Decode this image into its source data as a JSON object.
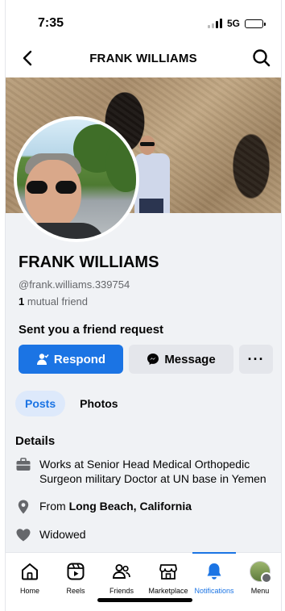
{
  "status_bar": {
    "time": "7:35",
    "network": "5G"
  },
  "header": {
    "title": "FRANK WILLIAMS"
  },
  "profile": {
    "name": "FRANK WILLIAMS",
    "handle": "@frank.williams.339754",
    "mutual_count": "1",
    "mutual_label": "mutual friend"
  },
  "request": {
    "title": "Sent you a friend request",
    "respond_label": "Respond",
    "message_label": "Message",
    "more_label": "···"
  },
  "tabs": [
    {
      "label": "Posts",
      "active": true
    },
    {
      "label": "Photos",
      "active": false
    }
  ],
  "details": {
    "title": "Details",
    "work": "Works at Senior Head Medical Orthopedic Surgeon military Doctor at UN base in Yemen",
    "from_prefix": "From ",
    "from_place": "Long Beach, California",
    "relationship": "Widowed"
  },
  "bottom_nav": [
    {
      "label": "Home",
      "icon": "home-icon"
    },
    {
      "label": "Reels",
      "icon": "reels-icon"
    },
    {
      "label": "Friends",
      "icon": "friends-icon"
    },
    {
      "label": "Marketplace",
      "icon": "marketplace-icon"
    },
    {
      "label": "Notifications",
      "icon": "bell-icon",
      "active": true
    },
    {
      "label": "Menu",
      "icon": "menu-avatar"
    }
  ],
  "colors": {
    "accent": "#1b74e4",
    "background": "#f0f2f5",
    "button_secondary": "#e4e6eb"
  }
}
